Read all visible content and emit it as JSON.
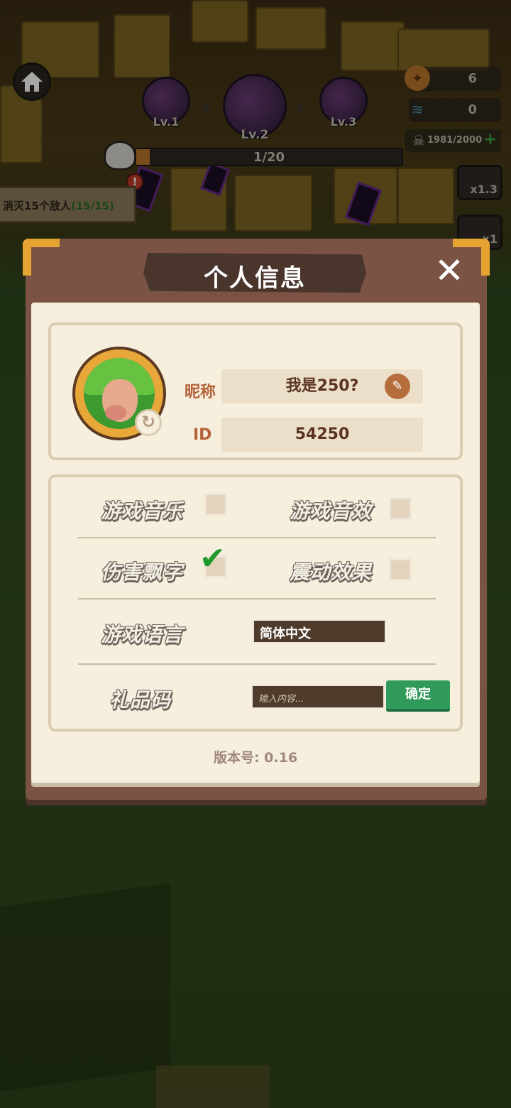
{
  "hud": {
    "units": [
      {
        "label": "Lv.1"
      },
      {
        "label": "Lv.2"
      },
      {
        "label": "Lv.3"
      }
    ],
    "wave_progress_text": "1/20",
    "wave_progress_fraction": 0.05,
    "quest": {
      "text": "消灭15个敌人",
      "progress": "(15/15)"
    },
    "alert_glyph": "!",
    "resources": {
      "gems": "6",
      "springs": "0",
      "kills": "1981/2000"
    },
    "speed_buttons": {
      "enemy_speed": "x1.3",
      "game_speed": "x1"
    }
  },
  "dialog": {
    "title": "个人信息",
    "close_glyph": "✕",
    "profile": {
      "nickname_label": "昵称",
      "nickname_value": "我是250?",
      "id_label": "ID",
      "id_value": "54250",
      "edit_glyph": "✎",
      "refresh_glyph": "↻"
    },
    "settings": {
      "music_label": "游戏音乐",
      "music_checked": false,
      "sfx_label": "游戏音效",
      "sfx_checked": false,
      "damage_text_label": "伤害飘字",
      "damage_text_checked": true,
      "vibration_label": "震动效果",
      "vibration_checked": false,
      "language_label": "游戏语言",
      "language_value": "简体中文",
      "gift_code_label": "礼品码",
      "gift_code_placeholder": "输入内容...",
      "confirm_label": "确定",
      "check_glyph": "✔"
    },
    "version_text": "版本号: 0.16"
  },
  "colors": {
    "dialog_frame": "#7a5345",
    "panel_bg": "#f6efdd",
    "accent_gold": "#e5a431",
    "confirm_green": "#2f9a5a",
    "label_orange": "#b4623a"
  }
}
